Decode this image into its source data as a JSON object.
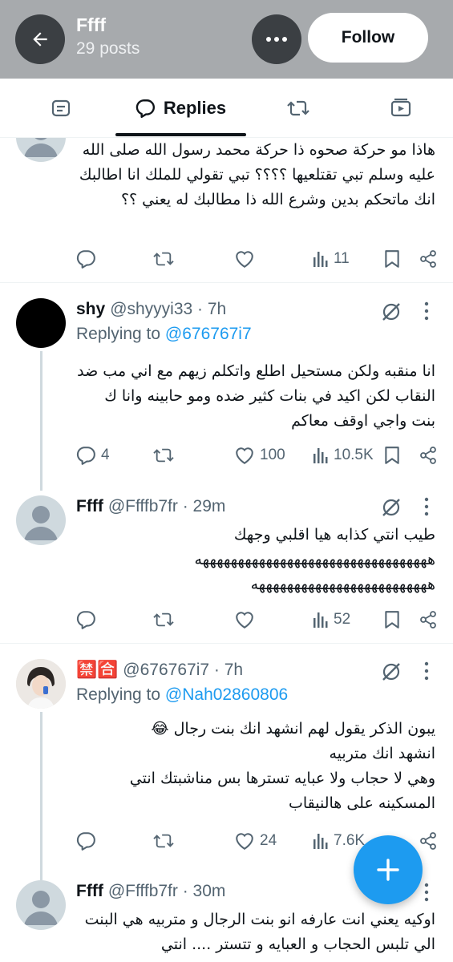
{
  "header": {
    "title": "Ffff",
    "posts_count": "29 posts",
    "follow_label": "Follow"
  },
  "tabs": [
    {
      "label": "",
      "icon": "posts-icon"
    },
    {
      "label": "Replies",
      "icon": "reply-bubble-icon",
      "active": true
    },
    {
      "label": "",
      "icon": "repost-icon"
    },
    {
      "label": "",
      "icon": "media-icon"
    }
  ],
  "tweets": [
    {
      "body": "هاذا مو حركة صحوه ذا حركة محمد رسول الله صلى الله عليه وسلم تبي تقتلعيها ؟؟؟؟ تبي تقولي للملك انا اطالبك انك ماتحكم بدين وشرع الله ذا مطالبك له يعني ؟؟",
      "views": "11"
    },
    {
      "name": "shy",
      "handle": "@shyyyi33 · 7h",
      "replying_prefix": "Replying to ",
      "replying_to": "@676767i7",
      "body": "انا منقبه ولكن مستحيل اطلع واتكلم زيهم مع اني مب ضد النقاب لكن اكيد في بنات كثير ضده ومو حابينه وانا ك بنت واجي اوقف معاكم",
      "replies": "4",
      "likes": "100",
      "views": "10.5K"
    },
    {
      "name": "Ffff",
      "handle": "@Ffffb7fr · 29m",
      "body_line1": "طيب انتي كذابه هيا اقلبي وجهك",
      "body_line2": "هههههههههههههههههههههههههههههههههه",
      "body_line3": "هههههههههههههههههههههههههه",
      "views": "52"
    },
    {
      "name": "🈲🈴",
      "handle": "@676767i7 · 7h",
      "replying_prefix": "Replying to ",
      "replying_to": "@Nah02860806",
      "body_line1": "يبون الذكر يقول لهم انشهد انك بنت رجال 😂",
      "body_line2": "انشهد انك متربيه",
      "body_line3": "وهي لا حجاب ولا عبايه تسترها بس مناشبتك انتي المسكينه على هالنيقاب",
      "likes": "24",
      "views": "7.6K"
    },
    {
      "name": "Ffff",
      "handle": "@Ffffb7fr · 30m",
      "body": "اوكيه يعني انت عارفه انو بنت الرجال و متربيه هي البنت الي تلبس الحجاب و العبايه و تتستر .... انتي"
    }
  ]
}
